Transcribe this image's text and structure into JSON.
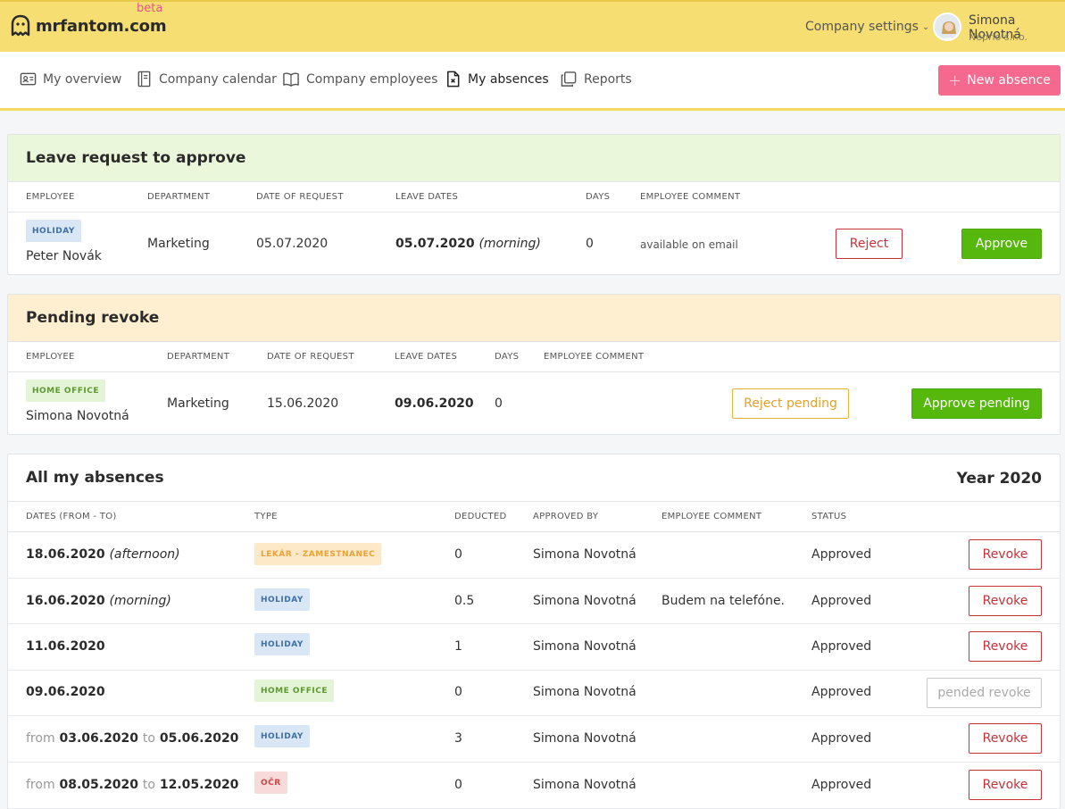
{
  "app": {
    "logo_text": "mrfantom.com",
    "beta": "beta"
  },
  "header": {
    "company_settings": "Company settings",
    "user_name": "Simona Novotná",
    "user_company": "Neprio s.r.o."
  },
  "nav": {
    "items": [
      {
        "label": "My overview",
        "icon": "id-card-icon"
      },
      {
        "label": "Company calendar",
        "icon": "notebook-icon"
      },
      {
        "label": "Company employees",
        "icon": "book-icon"
      },
      {
        "label": "My absences",
        "icon": "document-x-icon"
      },
      {
        "label": "Reports",
        "icon": "copy-icon"
      }
    ],
    "active": "My absences",
    "new_absence": "New absence"
  },
  "leave_request": {
    "title": "Leave request to approve",
    "headers": [
      "EMPLOYEE",
      "DEPARTMENT",
      "DATE OF REQUEST",
      "LEAVE DATES",
      "DAYS",
      "EMPLOYEE COMMENT"
    ],
    "row": {
      "badge": "HOLIDAY",
      "employee": "Peter Novák",
      "department": "Marketing",
      "date_of_request": "05.07.2020",
      "leave_date": "05.07.2020",
      "leave_part": "(morning)",
      "days": "0",
      "comment": "available on email",
      "reject": "Reject",
      "approve": "Approve"
    }
  },
  "pending_revoke": {
    "title": "Pending revoke",
    "headers": [
      "EMPLOYEE",
      "DEPARTMENT",
      "DATE OF REQUEST",
      "LEAVE DATES",
      "DAYS",
      "EMPLOYEE COMMENT"
    ],
    "row": {
      "badge": "HOME OFFICE",
      "employee": "Simona Novotná",
      "department": "Marketing",
      "date_of_request": "15.06.2020",
      "leave_date": "09.06.2020",
      "days": "0",
      "reject": "Reject pending",
      "approve": "Approve pending"
    }
  },
  "all_absences": {
    "title": "All my absences",
    "year": "Year 2020",
    "headers": [
      "DATES (FROM - TO)",
      "TYPE",
      "DEDUCTED",
      "APPROVED BY",
      "EMPLOYEE COMMENT",
      "STATUS"
    ],
    "rows": [
      {
        "from": "",
        "date": "18.06.2020",
        "to": "",
        "date2": "",
        "part": "(afternoon)",
        "type": "LEKÁR - ZAMESTNANEC",
        "deducted": "0",
        "approved_by": "Simona Novotná",
        "comment": "",
        "status": "Approved",
        "action": "Revoke"
      },
      {
        "from": "",
        "date": "16.06.2020",
        "to": "",
        "date2": "",
        "part": "(morning)",
        "type": "HOLIDAY",
        "deducted": "0.5",
        "approved_by": "Simona Novotná",
        "comment": "Budem na telefóne.",
        "status": "Approved",
        "action": "Revoke"
      },
      {
        "from": "",
        "date": "11.06.2020",
        "to": "",
        "date2": "",
        "part": "",
        "type": "HOLIDAY",
        "deducted": "1",
        "approved_by": "Simona Novotná",
        "comment": "",
        "status": "Approved",
        "action": "Revoke"
      },
      {
        "from": "",
        "date": "09.06.2020",
        "to": "",
        "date2": "",
        "part": "",
        "type": "HOME OFFICE",
        "deducted": "0",
        "approved_by": "Simona Novotná",
        "comment": "",
        "status": "Approved",
        "action": "pended revoke"
      },
      {
        "from": "from",
        "date": "03.06.2020",
        "to": "to",
        "date2": "05.06.2020",
        "part": "",
        "type": "HOLIDAY",
        "deducted": "3",
        "approved_by": "Simona Novotná",
        "comment": "",
        "status": "Approved",
        "action": "Revoke"
      },
      {
        "from": "from",
        "date": "08.05.2020",
        "to": "to",
        "date2": "12.05.2020",
        "part": "",
        "type": "OČR",
        "deducted": "0",
        "approved_by": "Simona Novotná",
        "comment": "",
        "status": "Approved",
        "action": "Revoke"
      }
    ]
  },
  "colors": {
    "topbar": "#f6de73",
    "accent_pink": "#f5698f",
    "approve_green": "#56b80d",
    "reject_red": "#c8303a",
    "pending_orange": "#e8b23a"
  }
}
